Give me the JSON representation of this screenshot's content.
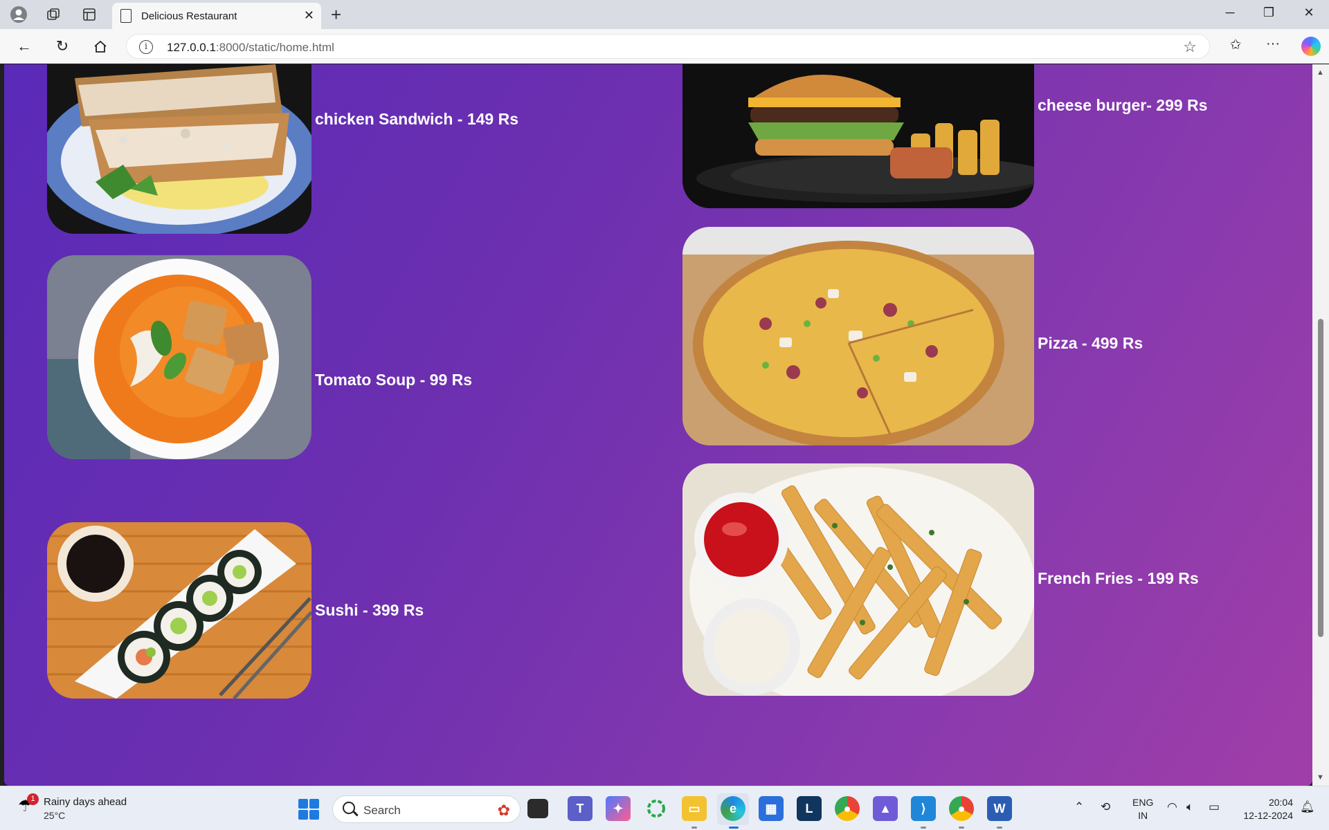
{
  "browser": {
    "tab_title": "Delicious Restaurant",
    "url_host": "127.0.0.1",
    "url_rest": ":8000/static/home.html"
  },
  "menu_items": [
    {
      "label": "chicken Sandwich - 149 Rs",
      "image": "chicken-sandwich"
    },
    {
      "label": "cheese burger- 299 Rs",
      "image": "cheese-burger"
    },
    {
      "label": "Tomato Soup - 99 Rs",
      "image": "tomato-soup"
    },
    {
      "label": "Pizza - 499 Rs",
      "image": "pizza"
    },
    {
      "label": "Sushi - 399 Rs",
      "image": "sushi"
    },
    {
      "label": "French Fries - 199 Rs",
      "image": "french-fries"
    }
  ],
  "taskbar": {
    "weather_badge": "1",
    "weather_title": "Rainy days ahead",
    "weather_temp": "25°C",
    "search_placeholder": "Search",
    "lang_line1": "ENG",
    "lang_line2": "IN",
    "time": "20:04",
    "date": "12-12-2024"
  },
  "colors": {
    "page_gradient_start": "#5a2ab8",
    "page_gradient_end": "#a03ea8",
    "label_text": "#ffffff"
  }
}
